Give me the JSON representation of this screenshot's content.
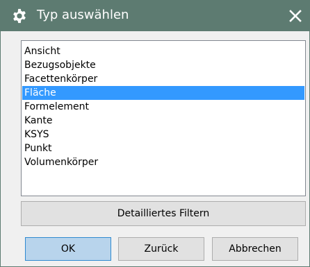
{
  "window": {
    "title": "Typ auswählen",
    "title_icon": "gear-icon",
    "close_icon": "close-icon"
  },
  "list": {
    "items": [
      {
        "label": "Ansicht",
        "selected": false
      },
      {
        "label": "Bezugsobjekte",
        "selected": false
      },
      {
        "label": "Facettenkörper",
        "selected": false
      },
      {
        "label": "Fläche",
        "selected": true
      },
      {
        "label": "Formelement",
        "selected": false
      },
      {
        "label": "Kante",
        "selected": false
      },
      {
        "label": "KSYS",
        "selected": false
      },
      {
        "label": "Punkt",
        "selected": false
      },
      {
        "label": "Volumenkörper",
        "selected": false
      }
    ]
  },
  "buttons": {
    "detail_filter": "Detailliertes Filtern",
    "ok": "OK",
    "back": "Zurück",
    "cancel": "Abbrechen"
  },
  "colors": {
    "titlebar": "#5d7b71",
    "selection": "#3399ff",
    "default_button": "#b8d4ec"
  }
}
